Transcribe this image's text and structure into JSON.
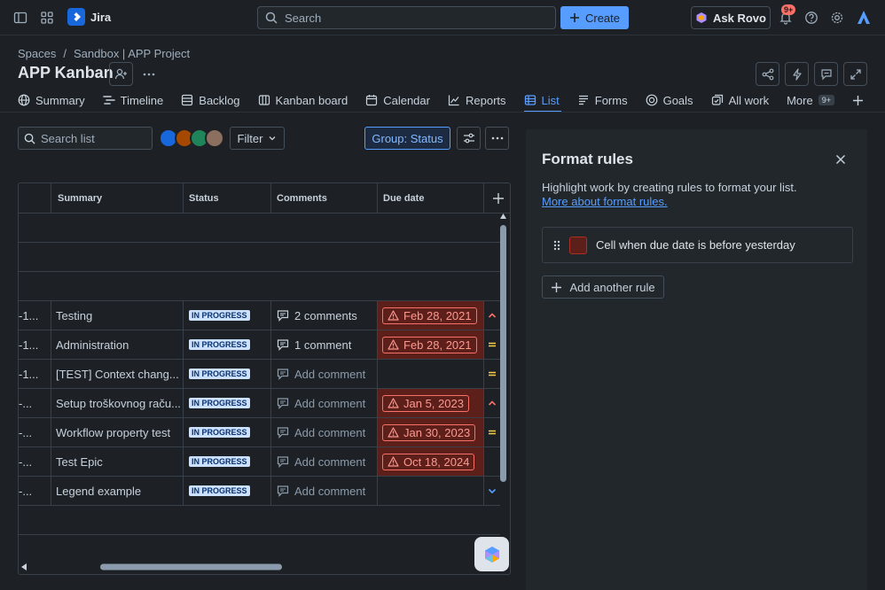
{
  "topbar": {
    "app_name": "Jira",
    "search_placeholder": "Search",
    "create_label": "Create",
    "rovo_label": "Ask Rovo",
    "notif_badge": "9+"
  },
  "header": {
    "breadcrumb": [
      "Spaces",
      "/",
      "Sandbox | APP Project"
    ],
    "title": "APP Kanban"
  },
  "tabs": [
    {
      "label": "Summary",
      "icon": "globe-icon"
    },
    {
      "label": "Timeline",
      "icon": "timeline-icon"
    },
    {
      "label": "Backlog",
      "icon": "backlog-icon"
    },
    {
      "label": "Kanban board",
      "icon": "board-icon"
    },
    {
      "label": "Calendar",
      "icon": "calendar-icon"
    },
    {
      "label": "Reports",
      "icon": "chart-icon"
    },
    {
      "label": "List",
      "icon": "list-icon",
      "active": true
    },
    {
      "label": "Forms",
      "icon": "forms-icon"
    },
    {
      "label": "Goals",
      "icon": "goals-icon"
    },
    {
      "label": "All work",
      "icon": "allwork-icon"
    }
  ],
  "more_tab": {
    "label": "More",
    "badge": "9+"
  },
  "toolbar": {
    "search_placeholder": "Search list",
    "filter_label": "Filter",
    "group_label": "Group: Status"
  },
  "table": {
    "columns": [
      "Summary",
      "Status",
      "Comments",
      "Due date"
    ],
    "rows": [
      {
        "key": "-1...",
        "summary": "Testing",
        "status": "IN PROGRESS",
        "comments": "2 comments",
        "has_comments": true,
        "due": "Feb 28, 2021",
        "priority": "high"
      },
      {
        "key": "-1...",
        "summary": "Administration",
        "status": "IN PROGRESS",
        "comments": "1 comment",
        "has_comments": true,
        "due": "Feb 28, 2021",
        "priority": "medium"
      },
      {
        "key": "-1...",
        "summary": "[TEST] Context chang...",
        "status": "IN PROGRESS",
        "comments": "Add comment",
        "has_comments": false,
        "due": "",
        "priority": "medium"
      },
      {
        "key": "-...",
        "summary": "Setup troškovnog raču...",
        "status": "IN PROGRESS",
        "comments": "Add comment",
        "has_comments": false,
        "due": "Jan 5, 2023",
        "priority": "high"
      },
      {
        "key": "-...",
        "summary": "Workflow property test",
        "status": "IN PROGRESS",
        "comments": "Add comment",
        "has_comments": false,
        "due": "Jan 30, 2023",
        "priority": "medium"
      },
      {
        "key": "-...",
        "summary": "Test Epic",
        "status": "IN PROGRESS",
        "comments": "Add comment",
        "has_comments": false,
        "due": "Oct 18, 2024",
        "priority": "none"
      },
      {
        "key": "-...",
        "summary": "Legend example",
        "status": "IN PROGRESS",
        "comments": "Add comment",
        "has_comments": false,
        "due": "",
        "priority": "low"
      }
    ]
  },
  "panel": {
    "title": "Format rules",
    "description": "Highlight work by creating rules to format your list.",
    "link": "More about format rules.",
    "rule_label": "Cell when due date is before yesterday",
    "rule_color": "#5d1f1a",
    "add_rule_label": "Add another rule"
  },
  "colors": {
    "accent": "#579dff",
    "overdue_bg": "#5d1f1a",
    "overdue_border": "#f87168"
  }
}
